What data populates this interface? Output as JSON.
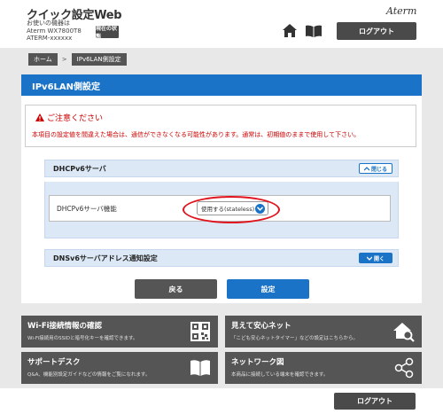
{
  "header": {
    "app_title": "クイック設定Web",
    "device_line1": "お使いの機器は",
    "device_line2": "Aterm WX7800T8",
    "device_line3": "ATERM-xxxxxx",
    "status_button": "現在の状態",
    "brand": "Aterm",
    "logout_label": "ログアウト"
  },
  "breadcrumb": {
    "home": "ホーム",
    "separator": ">",
    "current": "IPv6LAN側設定"
  },
  "page": {
    "title": "IPv6LAN側設定",
    "caution_title": "ご注意ください",
    "caution_text": "本項目の設定値を間違えた場合は、通信ができなくなる可能性があります。通常は、初期値のままで使用して下さい。"
  },
  "sections": {
    "dhcpv6": {
      "title": "DHCPv6サーバ",
      "toggle_label": "閉じる",
      "setting_label": "DHCPv6サーバ機能",
      "select_value": "使用する(stateless)"
    },
    "dns": {
      "title": "DNSv6サーバアドレス通知設定",
      "toggle_label": "開く"
    }
  },
  "actions": {
    "back": "戻る",
    "save": "設定"
  },
  "tiles": [
    {
      "title": "Wi-Fi接続情報の確認",
      "subtitle": "Wi-Fi接続用のSSIDと暗号化キーを確認できます。",
      "icon": "qr-code-icon"
    },
    {
      "title": "見えて安心ネット",
      "subtitle": "「こども安心ネットタイマー」などの設定はこちらから。",
      "icon": "home-search-icon"
    },
    {
      "title": "サポートデスク",
      "subtitle": "Q&A、機能別設定ガイドなどの情報をご覧になれます。",
      "icon": "book-icon"
    },
    {
      "title": "ネットワーク図",
      "subtitle": "本商品に接続している端末を確認できます。",
      "icon": "network-icon"
    }
  ],
  "footer": {
    "logout_label": "ログアウト"
  },
  "colors": {
    "accent": "#1a73c6",
    "dark_button": "#4a4a4a",
    "caution": "#cc0000",
    "highlight_ring": "#e0141e"
  }
}
